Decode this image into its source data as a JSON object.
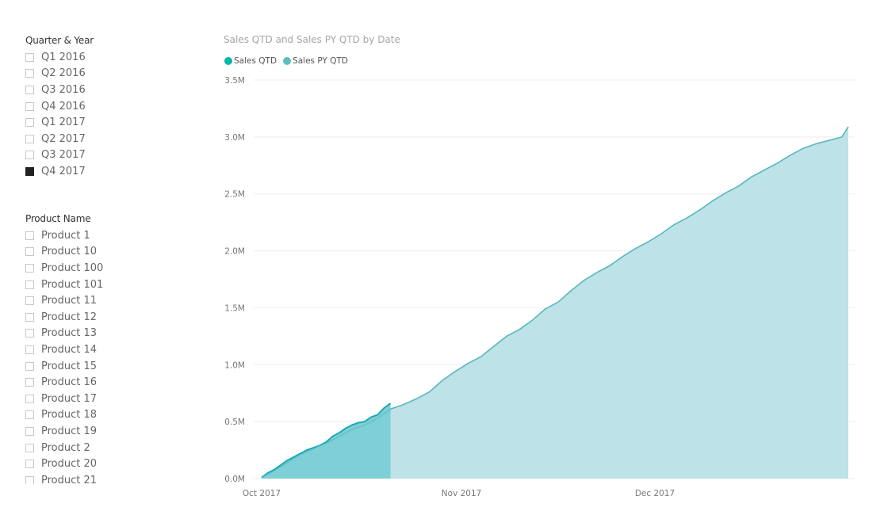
{
  "slicers": {
    "quarter": {
      "title": "Quarter & Year",
      "items": [
        {
          "label": "Q1 2016",
          "checked": false
        },
        {
          "label": "Q2 2016",
          "checked": false
        },
        {
          "label": "Q3 2016",
          "checked": false
        },
        {
          "label": "Q4 2016",
          "checked": false
        },
        {
          "label": "Q1 2017",
          "checked": false
        },
        {
          "label": "Q2 2017",
          "checked": false
        },
        {
          "label": "Q3 2017",
          "checked": false
        },
        {
          "label": "Q4 2017",
          "checked": true
        }
      ]
    },
    "product": {
      "title": "Product Name",
      "items": [
        {
          "label": "Product 1",
          "checked": false
        },
        {
          "label": "Product 10",
          "checked": false
        },
        {
          "label": "Product 100",
          "checked": false
        },
        {
          "label": "Product 101",
          "checked": false
        },
        {
          "label": "Product 11",
          "checked": false
        },
        {
          "label": "Product 12",
          "checked": false
        },
        {
          "label": "Product 13",
          "checked": false
        },
        {
          "label": "Product 14",
          "checked": false
        },
        {
          "label": "Product 15",
          "checked": false
        },
        {
          "label": "Product 16",
          "checked": false
        },
        {
          "label": "Product 17",
          "checked": false
        },
        {
          "label": "Product 18",
          "checked": false
        },
        {
          "label": "Product 19",
          "checked": false
        },
        {
          "label": "Product 2",
          "checked": false
        },
        {
          "label": "Product 20",
          "checked": false
        },
        {
          "label": "Product 21",
          "checked": false
        }
      ]
    }
  },
  "colors": {
    "sales_qtd_line": "#1aabb3",
    "sales_qtd_fill": "#7fcfd6",
    "sales_py_line": "#5bb8bd",
    "sales_py_fill": "#bde2e8",
    "legend_sales_qtd": "#01b8aa",
    "legend_sales_py": "#5fbcc0",
    "grid": "#eeeeee"
  },
  "chart_data": {
    "type": "area",
    "title": "Sales QTD and Sales PY QTD by Date",
    "legend": {
      "position": "top-left",
      "entries": [
        "Sales QTD",
        "Sales PY QTD"
      ]
    },
    "xlabel": "",
    "ylabel": "",
    "x_range_days": [
      0,
      91
    ],
    "x_ticks": [
      {
        "day": 0,
        "label": "Oct 2017"
      },
      {
        "day": 31,
        "label": "Nov 2017"
      },
      {
        "day": 61,
        "label": "Dec 2017"
      }
    ],
    "ylim": [
      0,
      3.5
    ],
    "y_unit": "M",
    "y_ticks": [
      {
        "value": 0,
        "label": "0.0M"
      },
      {
        "value": 0.5,
        "label": "0.5M"
      },
      {
        "value": 1.0,
        "label": "1.0M"
      },
      {
        "value": 1.5,
        "label": "1.5M"
      },
      {
        "value": 2.0,
        "label": "2.0M"
      },
      {
        "value": 2.5,
        "label": "2.5M"
      },
      {
        "value": 3.0,
        "label": "3.0M"
      },
      {
        "value": 3.5,
        "label": "3.5M"
      }
    ],
    "grid": true,
    "series": [
      {
        "name": "Sales QTD",
        "x_days": [
          0,
          1,
          2,
          3,
          4,
          5,
          6,
          7,
          8,
          9,
          10,
          11,
          12,
          13,
          14,
          15,
          16,
          17,
          18,
          19,
          20
        ],
        "values": [
          0.01,
          0.05,
          0.08,
          0.12,
          0.16,
          0.19,
          0.22,
          0.25,
          0.27,
          0.29,
          0.32,
          0.37,
          0.4,
          0.44,
          0.47,
          0.49,
          0.5,
          0.54,
          0.56,
          0.62,
          0.66
        ]
      },
      {
        "name": "Sales PY QTD",
        "x_days": [
          0,
          2,
          4,
          6,
          8,
          10,
          12,
          14,
          16,
          18,
          20,
          22,
          24,
          26,
          28,
          30,
          32,
          34,
          36,
          38,
          40,
          42,
          44,
          46,
          48,
          50,
          52,
          54,
          56,
          58,
          60,
          62,
          64,
          66,
          68,
          70,
          72,
          74,
          76,
          78,
          80,
          82,
          84,
          86,
          88,
          90,
          91
        ],
        "values": [
          0.01,
          0.07,
          0.14,
          0.21,
          0.26,
          0.31,
          0.37,
          0.43,
          0.47,
          0.53,
          0.61,
          0.65,
          0.7,
          0.76,
          0.86,
          0.94,
          1.01,
          1.07,
          1.16,
          1.25,
          1.31,
          1.39,
          1.49,
          1.55,
          1.65,
          1.74,
          1.81,
          1.87,
          1.95,
          2.02,
          2.08,
          2.15,
          2.23,
          2.29,
          2.36,
          2.44,
          2.51,
          2.57,
          2.65,
          2.71,
          2.77,
          2.84,
          2.9,
          2.94,
          2.97,
          3.0,
          3.09
        ]
      }
    ]
  }
}
